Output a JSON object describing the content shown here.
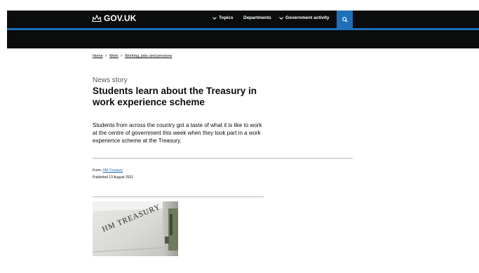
{
  "header": {
    "logo_text": "GOV.UK",
    "nav": {
      "topics": "Topics",
      "departments": "Departments",
      "government_activity": "Government activity"
    },
    "colors": {
      "background": "#0b0c0c",
      "accent": "#1d70b8"
    }
  },
  "breadcrumb": [
    "Home",
    "Work",
    "Working, jobs and pensions"
  ],
  "article": {
    "doc_type": "News story",
    "title": "Students learn about the Treasury in work experience scheme",
    "lead": "Students from across the country got a taste of what it is like to work at the centre of government this week when they took part in a work experience scheme at the Treasury.",
    "from_label": "From:",
    "from_org": "HM Treasury",
    "published": "Published 13 August 2021"
  },
  "image": {
    "sign_text": "HM TREASURY"
  }
}
